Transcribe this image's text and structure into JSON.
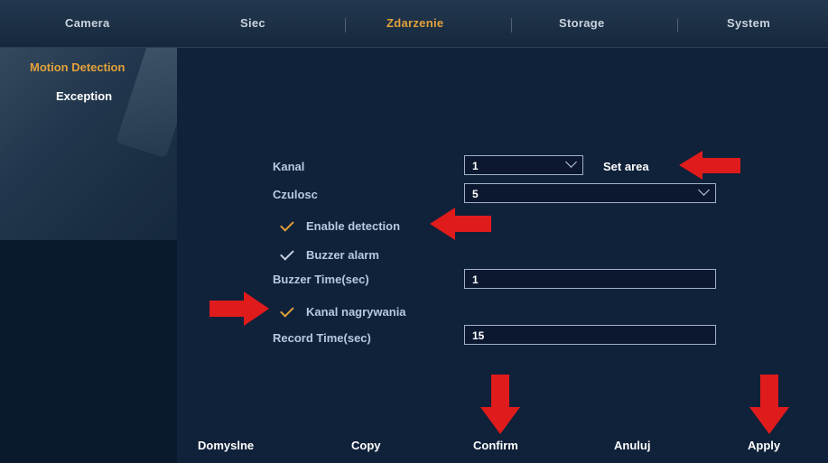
{
  "tabs": [
    "Camera",
    "Siec",
    "Zdarzenie",
    "Storage",
    "System"
  ],
  "sidebar": {
    "items": [
      "Motion Detection",
      "Exception"
    ]
  },
  "form": {
    "kanal_label": "Kanal",
    "kanal_value": "1",
    "set_area_label": "Set area",
    "czulosc_label": "Czulosc",
    "czulosc_value": "5",
    "enable_detection_label": "Enable detection",
    "enable_detection_checked": true,
    "buzzer_alarm_label": "Buzzer alarm",
    "buzzer_alarm_checked": true,
    "buzzer_time_label": "Buzzer Time(sec)",
    "buzzer_time_value": "1",
    "kanal_nagrywania_label": "Kanal nagrywania",
    "kanal_nagrywania_checked": true,
    "record_time_label": "Record Time(sec)",
    "record_time_value": "15"
  },
  "buttons": [
    "Domyslne",
    "Copy",
    "Confirm",
    "Anuluj",
    "Apply"
  ],
  "colors": {
    "accent": "#e3a13a",
    "annotation_arrow": "#e01b1b"
  }
}
